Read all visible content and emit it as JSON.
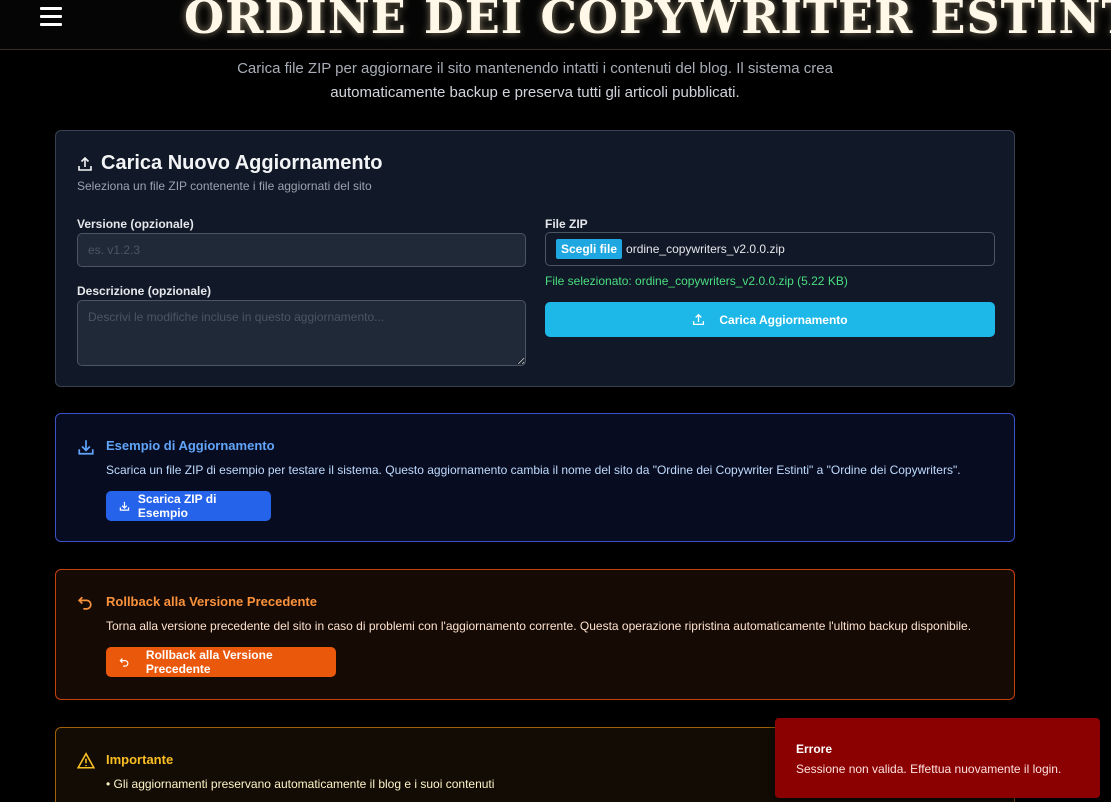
{
  "header": {
    "title": "ORDINE DEI COPYWRITER ESTINTI"
  },
  "intro": {
    "line1": "Carica file ZIP per aggiornare il sito mantenendo intatti i contenuti del blog. Il sistema crea",
    "line2": "automaticamente backup e preserva tutti gli articoli pubblicati."
  },
  "upload": {
    "title": "Carica Nuovo Aggiornamento",
    "subtitle": "Seleziona un file ZIP contenente i file aggiornati del sito",
    "version_label": "Versione (opzionale)",
    "version_placeholder": "es. v1.2.3",
    "version_value": "",
    "description_label": "Descrizione (opzionale)",
    "description_placeholder": "Descrivi le modifiche incluse in questo aggiornamento...",
    "zip_label": "File ZIP",
    "choose_file": "Scegli file",
    "file_name": "ordine_copywriters_v2.0.0.zip",
    "file_info": "File selezionato: ordine_copywriters_v2.0.0.zip (5.22 KB)",
    "submit_label": "Carica Aggiornamento"
  },
  "example": {
    "title": "Esempio di Aggiornamento",
    "text": "Scarica un file ZIP di esempio per testare il sistema. Questo aggiornamento cambia il nome del sito da \"Ordine dei Copywriter Estinti\" a \"Ordine dei Copywriters\".",
    "button": "Scarica ZIP di Esempio"
  },
  "rollback": {
    "title": "Rollback alla Versione Precedente",
    "text": "Torna alla versione precedente del sito in caso di problemi con l'aggiornamento corrente. Questa operazione ripristina automaticamente l'ultimo backup disponibile.",
    "button": "Rollback alla Versione Precedente"
  },
  "important": {
    "title": "Importante",
    "item1": "• Gli aggiornamenti preservano automaticamente il blog e i suoi contenuti"
  },
  "toast": {
    "title": "Errore",
    "message": "Sessione non valida. Effettua nuovamente il login."
  },
  "colors": {
    "primary": "#1eb8e8",
    "example_accent": "#2563eb",
    "rollback_accent": "#ea580c",
    "important_accent": "#fbbf24",
    "error": "#8b0000",
    "success_text": "#4ade80"
  },
  "icons": [
    "menu-icon",
    "upload-icon",
    "download-icon",
    "undo-icon",
    "warning-icon"
  ]
}
